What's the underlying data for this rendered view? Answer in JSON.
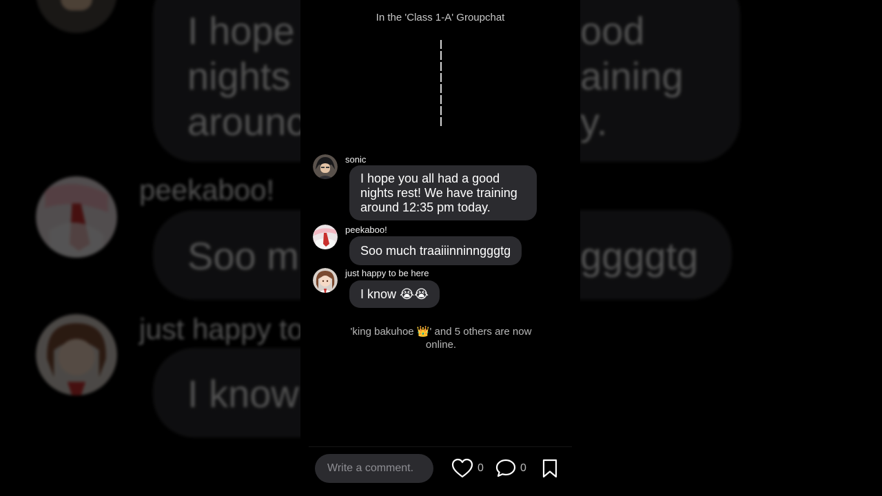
{
  "chat": {
    "title": "In the 'Class 1-A' Groupchat"
  },
  "messages": [
    {
      "sender": "sonic",
      "text": "I hope you all had a good nights rest! We have training around 12:35 pm today.",
      "avatar_icon": "dark-haired-character-avatar"
    },
    {
      "sender": "peekaboo!",
      "text": "Soo much traaiiinninngggtg",
      "avatar_icon": "red-tie-character-avatar"
    },
    {
      "sender": "just happy to be here",
      "text": "I know 😭😭",
      "avatar_icon": "brown-haired-girl-avatar"
    }
  ],
  "system_note": "'king bakuhoe 👑' and 5 others are now online.",
  "background": {
    "line1": "I hope",
    "line1b": "ood",
    "line2": "nights",
    "line2b": "aining",
    "line3": "arounc",
    "line3b": "y.",
    "name1": "peekaboo!",
    "text2": "Soo m",
    "text2b": "ggggtg",
    "name2": "just happy to",
    "text3": "I know"
  },
  "bottom_bar": {
    "comment_placeholder": "Write a comment.",
    "like_count": "0",
    "comment_count": "0"
  },
  "colors": {
    "bubble": "#2b2b2f",
    "background": "#000000",
    "secondary_text": "#c9c9c9"
  }
}
